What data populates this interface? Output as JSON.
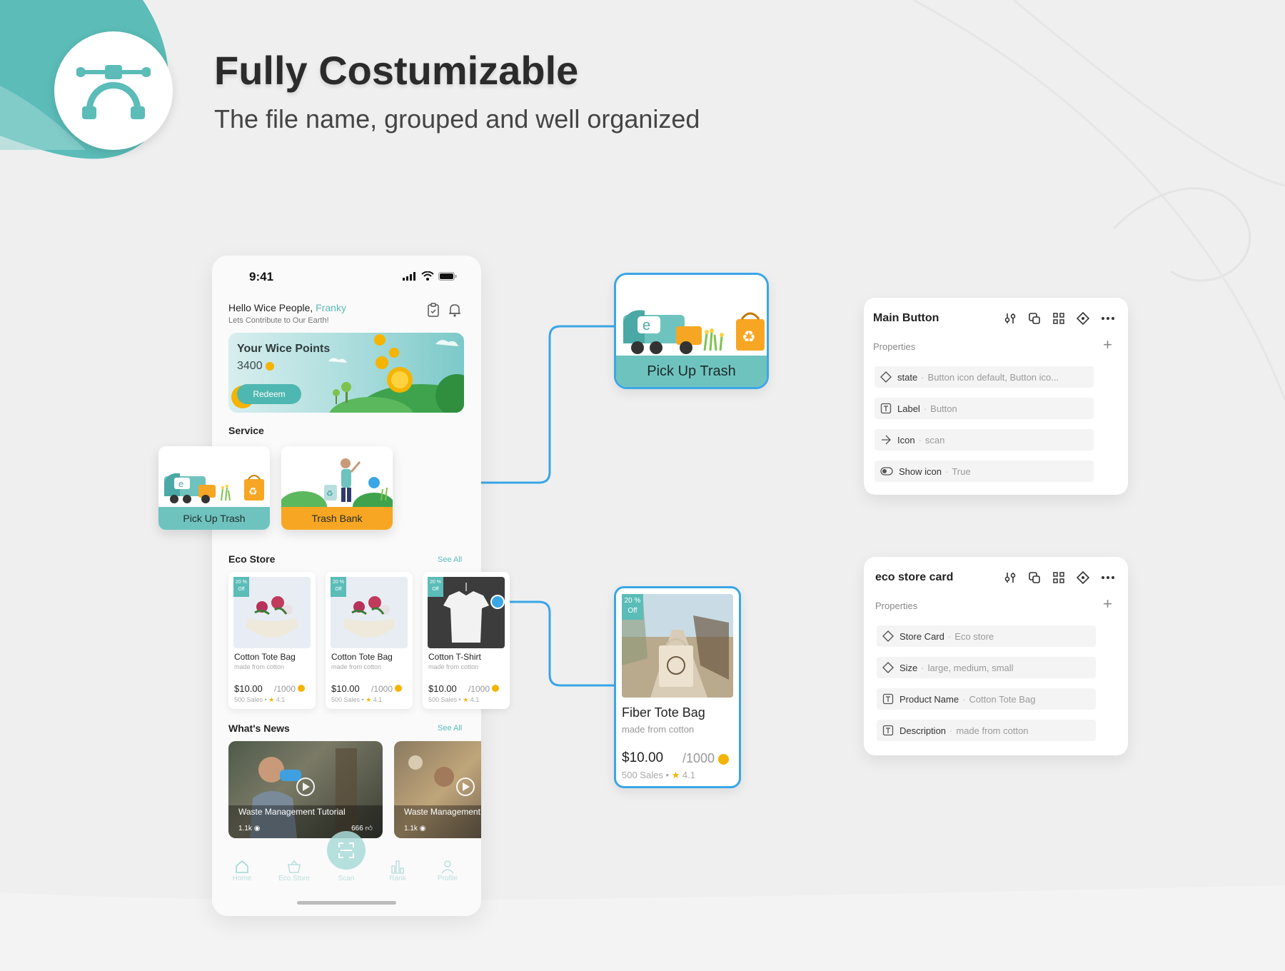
{
  "header": {
    "title": "Fully Costumizable",
    "subtitle": "The file name, grouped and well organized",
    "logo_icon": "bezier-pen-icon",
    "accent": "#5bbcb8"
  },
  "phone": {
    "time": "9:41",
    "greeting": "Hello Wice People,",
    "user_name": "Franky",
    "greeting_sub": "Lets Contribute to Our Earth!",
    "points": {
      "title": "Your Wice Points",
      "value": "3400",
      "redeem": "Redeem"
    },
    "service": {
      "title": "Service",
      "items": [
        {
          "label": "Pick Up Trash",
          "color": "#6fc3bf"
        },
        {
          "label": "Trash Bank",
          "color": "#f7a623"
        }
      ]
    },
    "eco_store": {
      "title": "Eco Store",
      "see_all": "See All",
      "products": [
        {
          "badge_pct": "20 %",
          "badge_off": "Off",
          "name": "Cotton Tote Bag",
          "desc": "made from cotton",
          "price": "$10.00",
          "points": "/1000",
          "sales": "500 Sales",
          "rating": "4.1"
        },
        {
          "badge_pct": "20 %",
          "badge_off": "Off",
          "name": "Cotton Tote Bag",
          "desc": "made from cotton",
          "price": "$10.00",
          "points": "/1000",
          "sales": "500 Sales",
          "rating": "4.1"
        },
        {
          "badge_pct": "20 %",
          "badge_off": "Off",
          "name": "Cotton T-Shirt",
          "desc": "made from cotton",
          "price": "$10.00",
          "points": "/1000",
          "sales": "500 Sales",
          "rating": "4.1"
        }
      ]
    },
    "news": {
      "title": "What's News",
      "see_all": "See All",
      "items": [
        {
          "title": "Waste Management Tutorial",
          "views": "1.1k",
          "likes": "666"
        },
        {
          "title": "Waste Management",
          "views": "1.1k",
          "likes": ""
        }
      ]
    },
    "tabs": [
      {
        "label": "Home",
        "icon": "home-icon"
      },
      {
        "label": "Eco Store",
        "icon": "basket-icon"
      },
      {
        "label": "Scan",
        "icon": "scan-icon"
      },
      {
        "label": "Rank",
        "icon": "bar-chart-icon"
      },
      {
        "label": "Profile",
        "icon": "user-icon"
      }
    ]
  },
  "callout_button": {
    "label": "Pick Up Trash"
  },
  "callout_card": {
    "badge_pct": "20 %",
    "badge_off": "Off",
    "name": "Fiber Tote Bag",
    "desc": "made from cotton",
    "price": "$10.00",
    "points": "/1000",
    "sales": "500 Sales",
    "rating": "4.1"
  },
  "panels": [
    {
      "title": "Main Button",
      "properties_label": "Properties",
      "rows": [
        {
          "icon": "variant-diamond-icon",
          "key": "state",
          "value": "Button icon default, Button ico..."
        },
        {
          "icon": "text-icon",
          "key": "Label",
          "value": "Button"
        },
        {
          "icon": "instance-swap-icon",
          "key": "Icon",
          "value": "scan"
        },
        {
          "icon": "toggle-icon",
          "key": "Show icon",
          "value": "True"
        }
      ]
    },
    {
      "title": "eco store card",
      "properties_label": "Properties",
      "rows": [
        {
          "icon": "variant-diamond-icon",
          "key": "Store Card",
          "value": "Eco store"
        },
        {
          "icon": "variant-diamond-icon",
          "key": "Size",
          "value": "large, medium, small"
        },
        {
          "icon": "text-icon",
          "key": "Product Name",
          "value": "Cotton Tote Bag"
        },
        {
          "icon": "text-icon",
          "key": "Description",
          "value": "made from cotton"
        }
      ]
    }
  ]
}
